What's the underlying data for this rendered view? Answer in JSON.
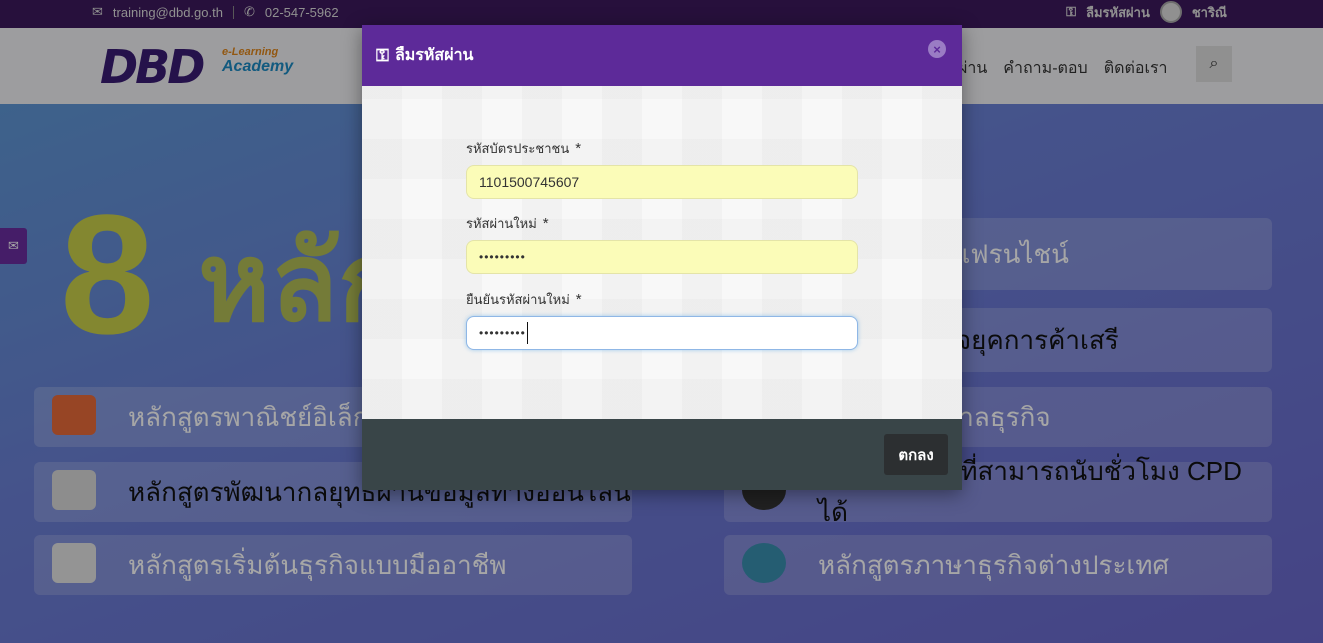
{
  "topbar": {
    "email": "training@dbd.go.th",
    "phone": "02-547-5962",
    "forgot_password": "ลืมรหัสผ่าน",
    "username": "ชาริณี"
  },
  "logo": {
    "main": "DBD",
    "sub1": "e-Learning",
    "sub2": "Academy"
  },
  "nav": {
    "items": [
      "ผ่าน",
      "คำถาม-ตอบ",
      "ติดต่อเรา"
    ]
  },
  "hero": {
    "big_number": "8",
    "big_text": "หลัก",
    "cards_left": [
      "หลักสูตรพาณิชย์อิเล็ก",
      "หลักสูตรพัฒนากลยุทธ์ผ่านข้อมูลทางออนไลน์",
      "หลักสูตรเริ่มต้นธุรกิจแบบมืออาชีพ"
    ],
    "cards_right": [
      "เริ่มต้นธุรกิจแฟรนไชน์",
      "ประกอบธุรกิจยุคการค้าเสรี",
      "และธรรมภิบาลธุรกิจ",
      "หลักสูตรวิชาที่สามารถนับชั่วโมง CPD ได้",
      "หลักสูตรภาษาธุรกิจต่างประเทศ"
    ]
  },
  "modal": {
    "title": "ลืมรหัสผ่าน",
    "fields": [
      {
        "label": "รหัสบัตรประชาชน",
        "required": "*",
        "value": "1101500745607"
      },
      {
        "label": "รหัสผ่านใหม่",
        "required": "*",
        "value": "•••••••••"
      },
      {
        "label": "ยืนยันรหัสผ่านใหม่",
        "required": "*",
        "value": "•••••••••"
      }
    ],
    "ok_label": "ตกลง",
    "close_label": "×"
  },
  "colors": {
    "header_purple": "#5d2a99",
    "topbar": "#3d1a5c",
    "footer": "#394548",
    "autofill_yellow": "#fbfcb8"
  }
}
